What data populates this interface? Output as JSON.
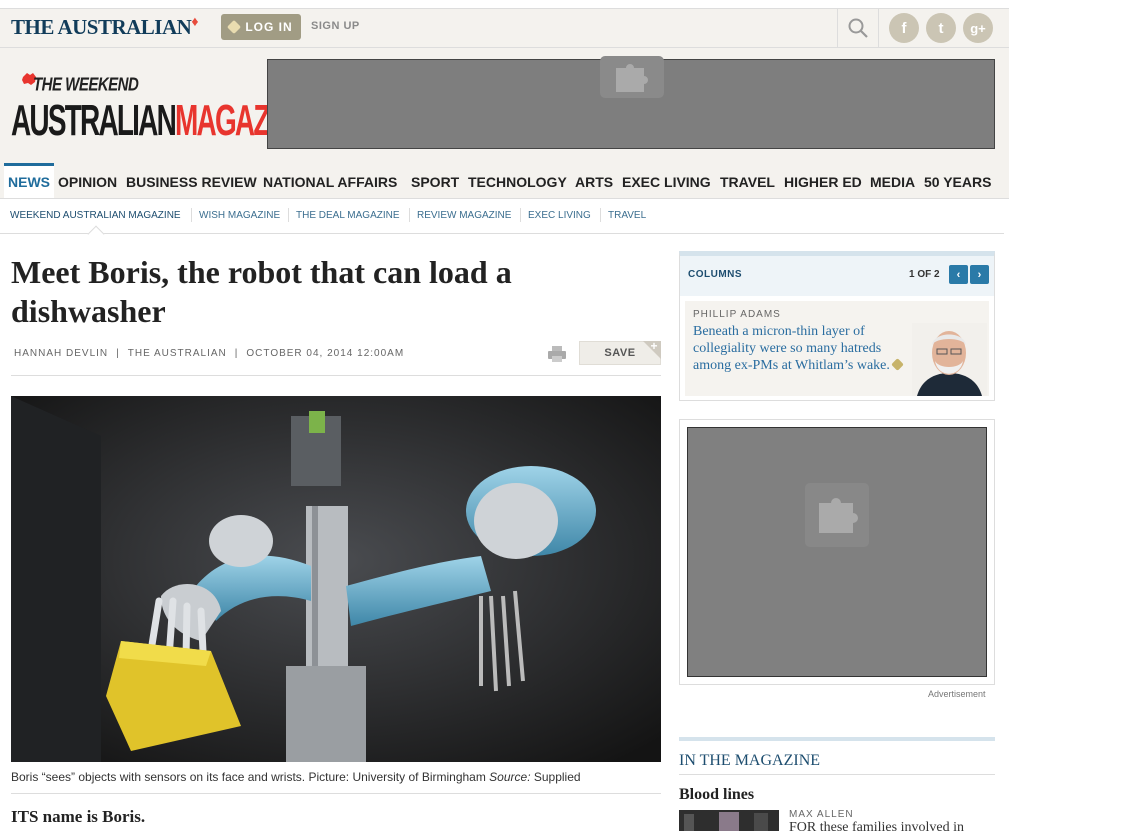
{
  "header": {
    "brand": "THE AUSTRALIAN",
    "login_label": "LOG IN",
    "signup_label": "SIGN UP",
    "social": {
      "facebook": "f",
      "twitter": "t",
      "googleplus": "g+"
    }
  },
  "masthead": {
    "logo_small": "THE WEEKEND",
    "logo_word1": "AUSTRALIAN",
    "logo_word2": "MAGAZINE"
  },
  "nav": {
    "items": [
      "NEWS",
      "OPINION",
      "BUSINESS REVIEW",
      "NATIONAL AFFAIRS",
      "SPORT",
      "TECHNOLOGY",
      "ARTS",
      "EXEC LIVING",
      "TRAVEL",
      "HIGHER ED",
      "MEDIA",
      "50 YEARS"
    ]
  },
  "subnav": {
    "items": [
      "WEEKEND AUSTRALIAN MAGAZINE",
      "WISH MAGAZINE",
      "THE DEAL MAGAZINE",
      "REVIEW MAGAZINE",
      "EXEC LIVING",
      "TRAVEL"
    ]
  },
  "article": {
    "headline": "Meet Boris, the robot that can load a dishwasher",
    "author": "HANNAH DEVLIN",
    "publication": "THE AUSTRALIAN",
    "date": "OCTOBER 04, 2014 12:00AM",
    "sep": "|",
    "save_label": "SAVE",
    "caption_main": "Boris “sees” objects with sensors on its face and wrists. Picture: University of Birmingham ",
    "caption_source_label": "Source:",
    "caption_source": " Supplied",
    "lead": "ITS name is Boris."
  },
  "columns": {
    "title": "COLUMNS",
    "count": "1 OF 2",
    "prev": "‹",
    "next": "›",
    "author": "PHILLIP ADAMS",
    "text": "Beneath a micron-thin layer of collegiality were so many hatreds among ex-PMs at Whitlam’s wake."
  },
  "ad": {
    "label": "Advertisement"
  },
  "magazine": {
    "title": "IN THE MAGAZINE",
    "story_title": "Blood lines",
    "story_author": "MAX ALLEN",
    "story_text": "FOR these families involved in"
  },
  "colors": {
    "brand_navy": "#113c5a",
    "accent_red": "#e8352e",
    "link_blue": "#2a6da0",
    "nav_active": "#1f6c9c"
  }
}
